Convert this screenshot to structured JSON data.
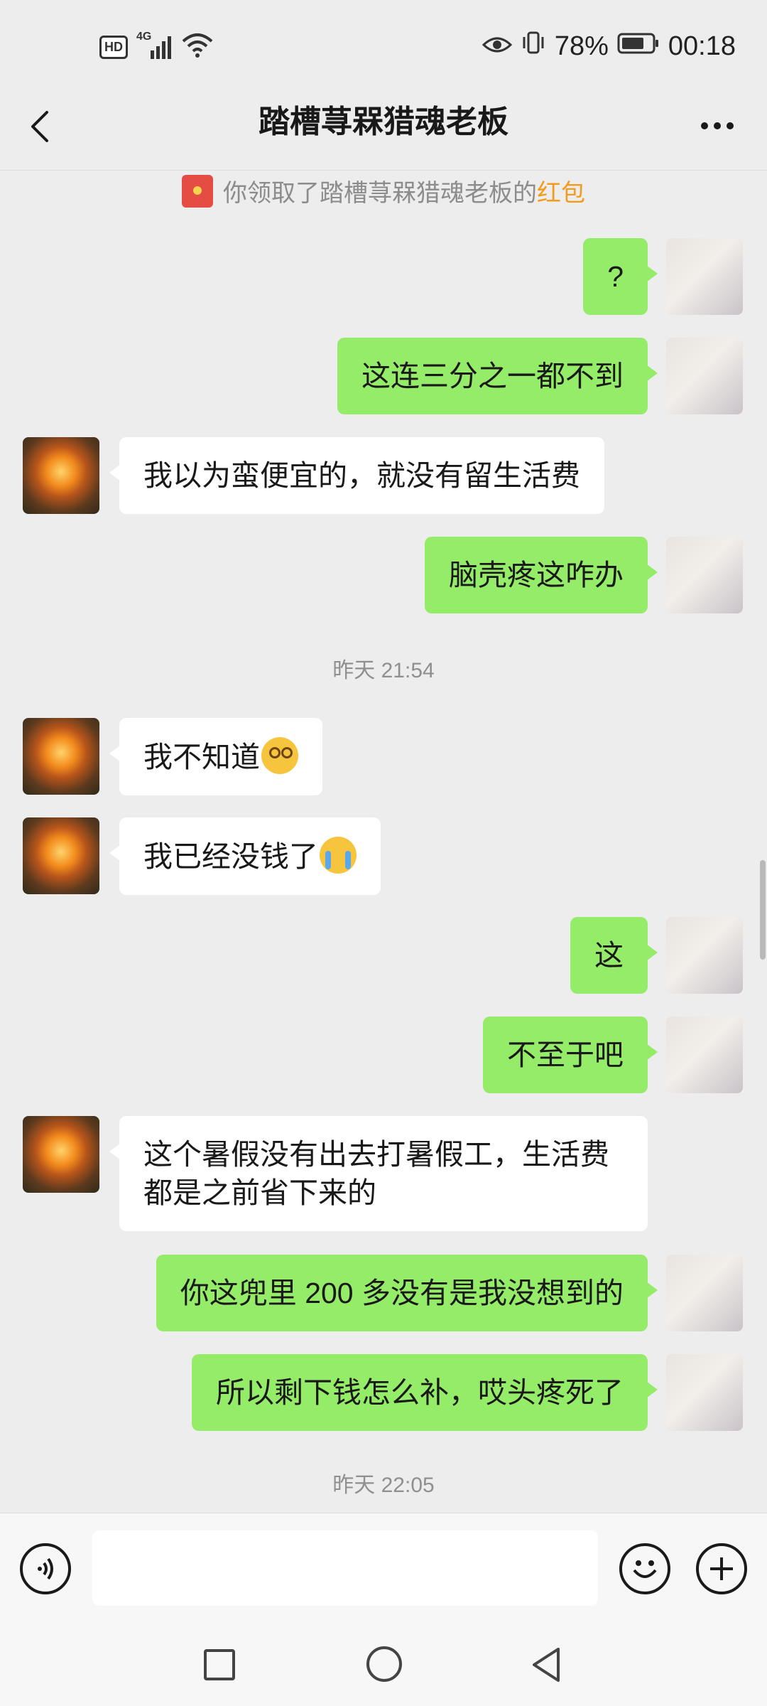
{
  "status_bar": {
    "network_badge": "HD",
    "network_type": "4G",
    "battery_percent": "78%",
    "time": "00:18",
    "icons": [
      "hd-icon",
      "signal-icon",
      "wifi-icon",
      "eye-icon",
      "vibrate-icon",
      "battery-icon"
    ]
  },
  "header": {
    "title": "踏槽荨槑猎魂老板",
    "back_icon": "chevron-left-icon",
    "more_icon": "more-horizontal-icon"
  },
  "notice": {
    "text": "你领取了踏槽荨槑猎魂老板的",
    "link": "红包"
  },
  "messages": [
    {
      "from": "me",
      "text": "?"
    },
    {
      "from": "me",
      "text": "这连三分之一都不到"
    },
    {
      "from": "other",
      "text": "我以为蛮便宜的，就没有留生活费"
    },
    {
      "from": "me",
      "text": "脑壳疼这咋办"
    },
    {
      "from": "other",
      "text": "我不知道",
      "emoji": "dizzy-face"
    },
    {
      "from": "other",
      "text": "我已经没钱了",
      "emoji": "crying-face"
    },
    {
      "from": "me",
      "text": "这"
    },
    {
      "from": "me",
      "text": "不至于吧"
    },
    {
      "from": "other",
      "text": "这个暑假没有出去打暑假工，生活费都是之前省下来的"
    },
    {
      "from": "me",
      "text": "你这兜里 200 多没有是我没想到的"
    },
    {
      "from": "me",
      "text": "所以剩下钱怎么补，哎头疼死了"
    }
  ],
  "timestamps": [
    "昨天 21:54",
    "昨天 22:05"
  ],
  "input_bar": {
    "placeholder": "",
    "icons": [
      "voice-icon",
      "emoji-icon",
      "plus-icon"
    ]
  },
  "colors": {
    "my_bubble": "#95ec69",
    "other_bubble": "#ffffff",
    "background": "#ededed",
    "link": "#f39b1c"
  }
}
